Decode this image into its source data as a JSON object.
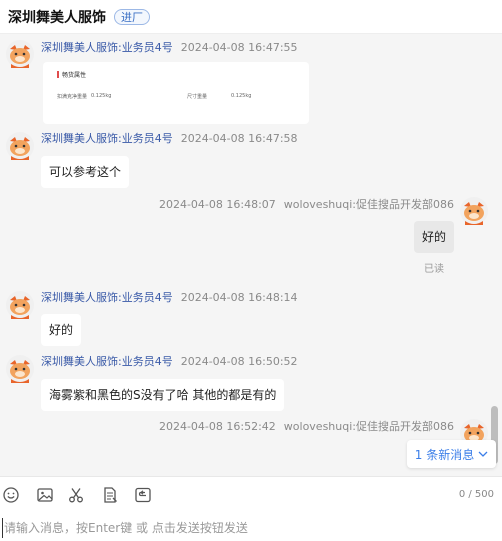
{
  "header": {
    "shop_name": "深圳舞美人服饰",
    "enter_label": "进厂"
  },
  "messages": [
    {
      "side": "left",
      "sender": "深圳舞美人服饰:业务员4号",
      "time": "2024-04-08 16:47:55",
      "type": "image",
      "card": {
        "title": "畅货属性",
        "left_label": "扣满克净重量",
        "left_value": "0.125kg",
        "right_label": "尺寸重量",
        "right_value": "0.125kg"
      }
    },
    {
      "side": "left",
      "sender": "深圳舞美人服饰:业务员4号",
      "time": "2024-04-08 16:47:58",
      "text": "可以参考这个"
    },
    {
      "side": "right",
      "sender": "woloveshuqi:促佳搜品开发部086",
      "time": "2024-04-08 16:48:07",
      "text": "好的",
      "status": "已读"
    },
    {
      "side": "left",
      "sender": "深圳舞美人服饰:业务员4号",
      "time": "2024-04-08 16:48:14",
      "text": "好的"
    },
    {
      "side": "left",
      "sender": "深圳舞美人服饰:业务员4号",
      "time": "2024-04-08 16:50:52",
      "text": "海雾紫和黑色的S没有了哈 其他的都是有的"
    },
    {
      "side": "right",
      "sender": "woloveshuqi:促佳搜品开发部086",
      "time": "2024-04-08 16:52:42"
    }
  ],
  "new_messages": {
    "label": "1 条新消息"
  },
  "toolbar": {
    "tools": [
      "emoji-icon",
      "image-icon",
      "scissors-icon",
      "document-icon",
      "history-icon"
    ],
    "counter": "0 / 500"
  },
  "input": {
    "placeholder": "请输入消息，按Enter键 或 点击发送按钮发送",
    "value": ""
  },
  "colors": {
    "accent": "#3b7ee8",
    "chat_bg": "#f5f5f5",
    "sender": "#3a5aa8"
  }
}
